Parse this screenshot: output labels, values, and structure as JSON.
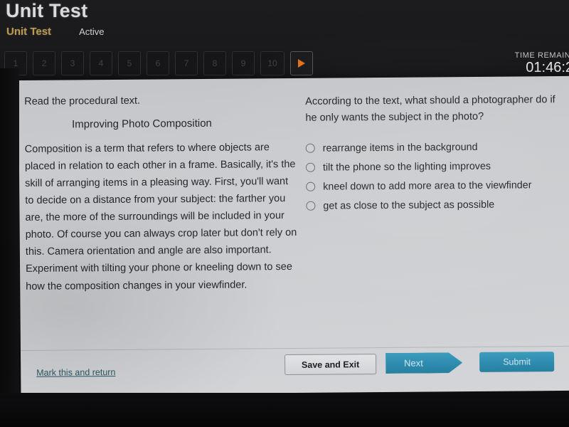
{
  "header": {
    "app_title": "Unit Test",
    "breadcrumb": "Unit Test",
    "status": "Active",
    "timer_label": "TIME REMAINI",
    "timer_value": "01:46:2"
  },
  "question_nav": {
    "numbers": [
      "1",
      "2",
      "3",
      "4",
      "5",
      "6",
      "7",
      "8",
      "9",
      "10"
    ],
    "next_arrow_icon": "play-triangle-icon"
  },
  "passage": {
    "instruction": "Read the procedural text.",
    "heading": "Improving Photo Composition",
    "body": "Composition is a term that refers to where objects are placed in relation to each other in a frame. Basically, it's the skill of arranging items in a pleasing way. First, you'll want to decide on a distance from your subject: the farther you are, the more of the surroundings will be included in your photo. Of course you can always crop later but don't rely on this. Camera orientation and angle are also important. Experiment with tilting your phone or kneeling down to see how the composition changes in your viewfinder."
  },
  "question": {
    "prompt": "According to the text, what should a photographer do if he only wants the subject in the photo?",
    "options": [
      {
        "label": "rearrange items in the background",
        "selected": false
      },
      {
        "label": "tilt the phone so the lighting improves",
        "selected": false
      },
      {
        "label": "kneel down to add more area to the viewfinder",
        "selected": false
      },
      {
        "label": "get as close to the subject as possible",
        "selected": false
      }
    ]
  },
  "footer": {
    "mark_link": "Mark this and return",
    "save_and_exit": "Save and Exit",
    "next": "Next",
    "submit": "Submit"
  },
  "colors": {
    "accent_orange": "#e2701a",
    "breadcrumb_gold": "#b99a57",
    "button_teal": "#2d8cb0",
    "link_teal": "#2c5866",
    "chrome_dark": "#1a1a1c"
  }
}
